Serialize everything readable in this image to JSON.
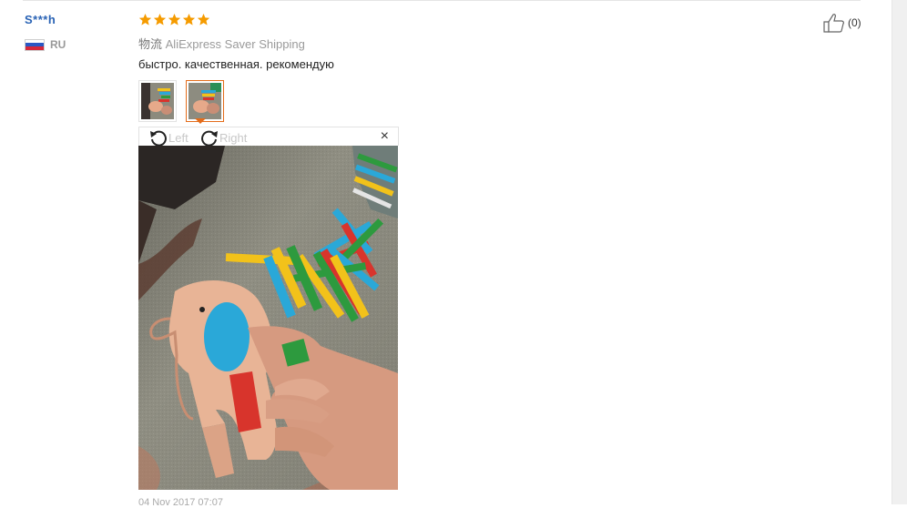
{
  "review": {
    "user_name": "S***h",
    "country_code": "RU",
    "rating": 5,
    "shipping_label": "物流",
    "shipping_method": "AliExpress Saver Shipping",
    "text": "быстро. качественная. рекомендую",
    "helpful_count": "(0)",
    "date": "04 Nov 2017 07:07"
  },
  "viewer": {
    "rotate_left_label": "Left",
    "rotate_right_label": "Right",
    "close_symbol": "×"
  },
  "icons": {
    "star": "star-icon",
    "thumbs_up": "thumbs-up-icon",
    "rotate_left": "rotate-left-icon",
    "rotate_right": "rotate-right-icon",
    "close": "close-icon"
  },
  "colors": {
    "username": "#2a63b5",
    "star": "#f59b00",
    "active_border": "#e46c1a"
  }
}
